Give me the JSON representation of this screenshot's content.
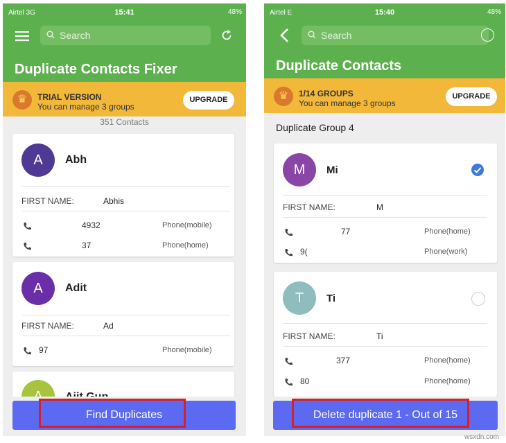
{
  "left": {
    "status": {
      "carrier": "Airtel  3G",
      "time": "15:41",
      "battery": "48%"
    },
    "search_placeholder": "Search",
    "title": "Duplicate Contacts Fixer",
    "banner": {
      "line1": "TRIAL VERSION",
      "line2": "You can manage 3 groups",
      "upgrade": "UPGRADE"
    },
    "contacts_count": "351 Contacts",
    "cards": [
      {
        "initial": "A",
        "name": "Abh",
        "first_name_label": "FIRST NAME:",
        "first_name": "Abhis",
        "phones": [
          {
            "number": "4932",
            "type": "Phone(mobile)"
          },
          {
            "number": "37",
            "type": "Phone(home)"
          }
        ]
      },
      {
        "initial": "A",
        "name": "Adit",
        "first_name_label": "FIRST NAME:",
        "first_name": "Ad",
        "phones": [
          {
            "number": "97",
            "type": "Phone(mobile)"
          }
        ]
      },
      {
        "initial": "A",
        "name": "Ajit Gup"
      }
    ],
    "cta": "Find Duplicates"
  },
  "right": {
    "status": {
      "carrier": "Airtel  E",
      "time": "15:40",
      "battery": "48%"
    },
    "search_placeholder": "Search",
    "title": "Duplicate Contacts",
    "banner": {
      "line1": "1/14 GROUPS",
      "line2": "You can manage 3 groups",
      "upgrade": "UPGRADE"
    },
    "group_label": "Duplicate Group 4",
    "cards": [
      {
        "initial": "M",
        "name": "Mi",
        "first_name_label": "FIRST NAME:",
        "first_name": "M",
        "phones": [
          {
            "number": "77",
            "type": "Phone(home)"
          },
          {
            "number": "9(",
            "type": "Phone(work)"
          }
        ],
        "selected": true
      },
      {
        "initial": "T",
        "name": "Ti",
        "first_name_label": "FIRST NAME:",
        "first_name": "Ti",
        "phones": [
          {
            "number": "377",
            "type": "Phone(home)"
          },
          {
            "number": "80",
            "type": "Phone(home)"
          }
        ],
        "selected": false
      }
    ],
    "cta": "Delete duplicate 1 - Out of 15"
  },
  "watermark": "wsxdn.com",
  "colors": {
    "green": "#5db04e",
    "banner": "#f2b83a",
    "button": "#5b6af0",
    "highlight": "#d81f26",
    "check": "#3d7be0"
  }
}
